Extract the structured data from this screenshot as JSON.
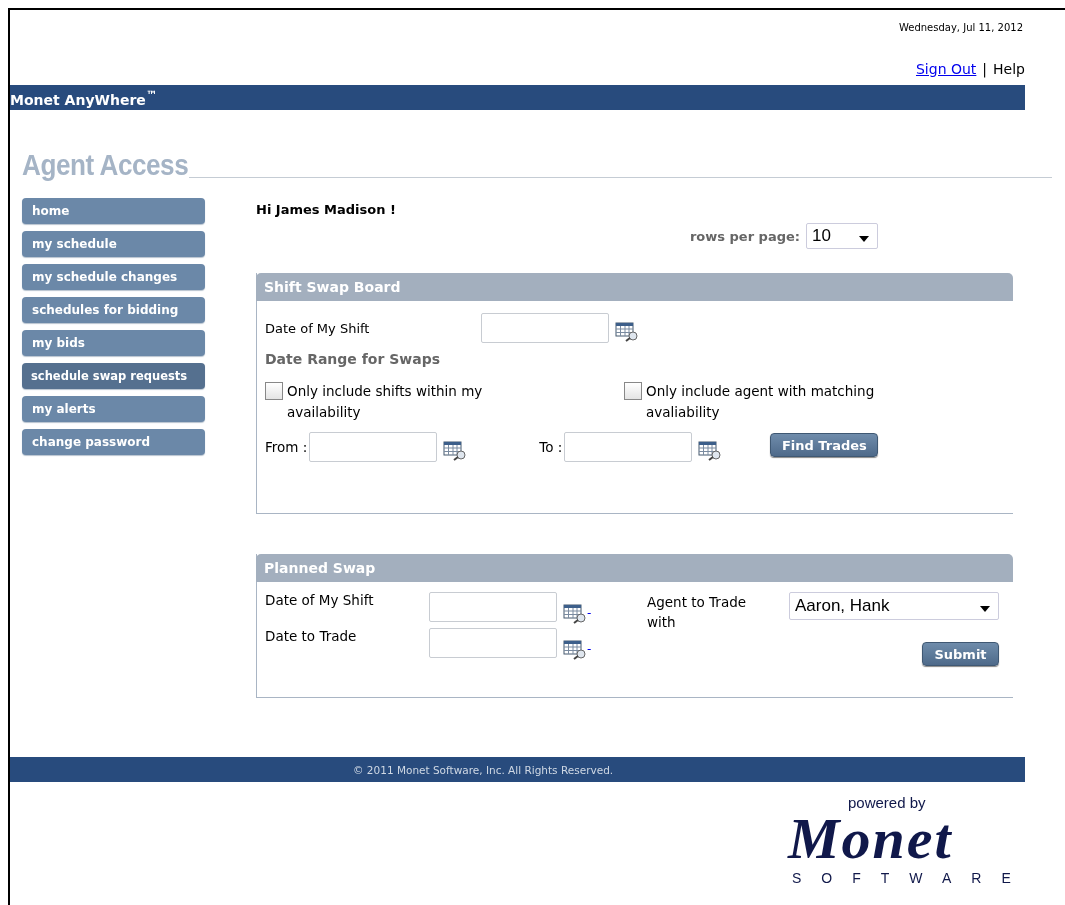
{
  "date": "Wednesday, Jul 11, 2012",
  "top_links": [
    {
      "label": "Sign Out",
      "kind": "link"
    },
    {
      "label": "Help",
      "kind": "text"
    }
  ],
  "separator": "|",
  "brand": "Monet AnyWhere$^{™}$",
  "page_title": "Agent Access",
  "sidebar": {
    "items": [
      {
        "label": "home",
        "selected": false
      },
      {
        "label": "my schedule",
        "selected": false
      },
      {
        "label": "my schedule changes",
        "selected": false
      },
      {
        "label": "schedules for bidding",
        "selected": false
      },
      {
        "label": "my bids",
        "selected": false
      },
      {
        "label": "schedule swap requests",
        "selected": true
      },
      {
        "label": "my alerts",
        "selected": false
      },
      {
        "label": "change password",
        "selected": false
      }
    ]
  },
  "greeting": "Hi James Madison !",
  "rows_per_page": {
    "label": "rows per page:",
    "value": "10"
  },
  "shift_swap_board": {
    "title": "Shift Swap Board",
    "date_label": "Date of My Shift",
    "range_label": "Date Range for Swaps",
    "checkboxes": [
      {
        "label": "Only include shifts within my availability",
        "checked": false
      },
      {
        "label": "Only include agent with matching avaliability",
        "checked": false
      }
    ],
    "from_label": "From :",
    "to_label": "To :",
    "button": "Find Trades"
  },
  "planned_swap": {
    "title": "Planned Swap",
    "fields": [
      {
        "label": "Date of My Shift",
        "suffix": "-"
      },
      {
        "label": "Date to Trade",
        "suffix": "-"
      }
    ],
    "agent": {
      "label": "Agent to Trade with",
      "value": "Aaron, Hank"
    },
    "button": "Submit"
  },
  "footer": "© 2011 Monet Software, Inc. All Rights Reserved.",
  "logo": {
    "powered_by": "powered by",
    "name": "Monet",
    "tagline": "SOFTWARE"
  }
}
